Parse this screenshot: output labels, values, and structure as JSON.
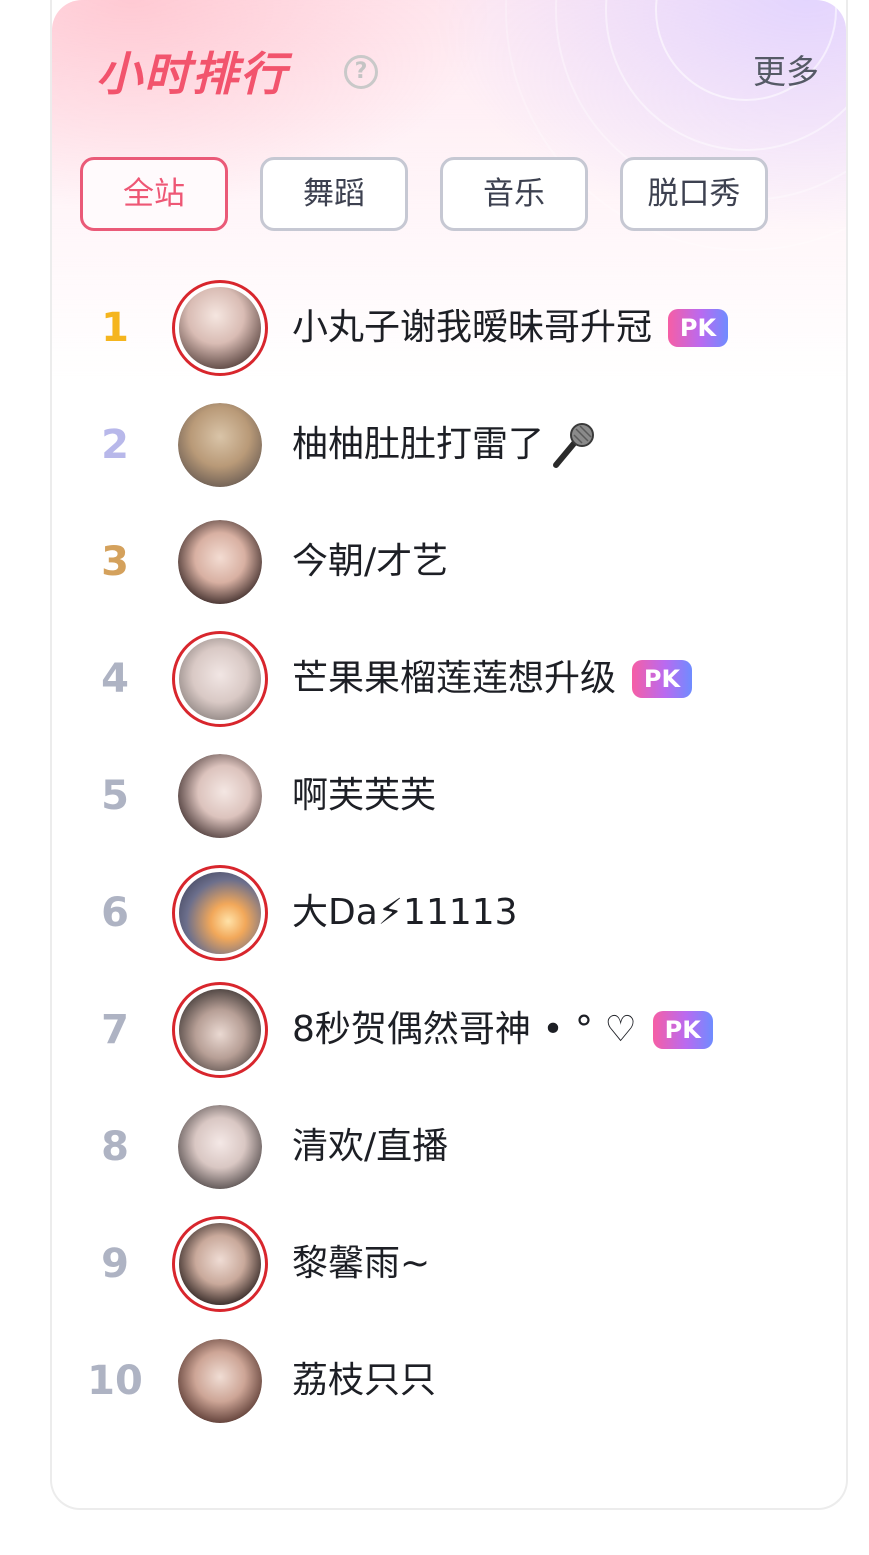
{
  "header": {
    "title": "小时排行",
    "help_icon": "?",
    "more_label": "更多"
  },
  "tabs": [
    {
      "label": "全站",
      "active": true
    },
    {
      "label": "舞蹈",
      "active": false
    },
    {
      "label": "音乐",
      "active": false
    },
    {
      "label": "脱口秀",
      "active": false
    }
  ],
  "colors": {
    "accent": "#f2546d",
    "rank_gold": "#f5b51e",
    "rank_silver": "#b8b8ea",
    "rank_bronze": "#d4a15c",
    "rank_default": "#aeb3c3",
    "live_ring": "#d8262d"
  },
  "ranking": [
    {
      "rank": "1",
      "name": "小丸子谢我暧昧哥升冠",
      "badge": "PK",
      "live": true
    },
    {
      "rank": "2",
      "name": "柚柚肚肚打雷了",
      "icon": "microphone-icon",
      "live": false
    },
    {
      "rank": "3",
      "name": "今朝/才艺",
      "live": false
    },
    {
      "rank": "4",
      "name": "芒果果榴莲莲想升级",
      "badge": "PK",
      "live": true
    },
    {
      "rank": "5",
      "name": "啊芙芙芙",
      "live": false
    },
    {
      "rank": "6",
      "name": "大Da⚡11113",
      "live": true
    },
    {
      "rank": "7",
      "name": "8秒贺偶然哥神 • ° ♡",
      "badge": "PK",
      "live": true
    },
    {
      "rank": "8",
      "name": "清欢/直播",
      "live": false
    },
    {
      "rank": "9",
      "name": "黎馨雨~",
      "live": true
    },
    {
      "rank": "10",
      "name": "荔枝只只",
      "live": false
    }
  ]
}
